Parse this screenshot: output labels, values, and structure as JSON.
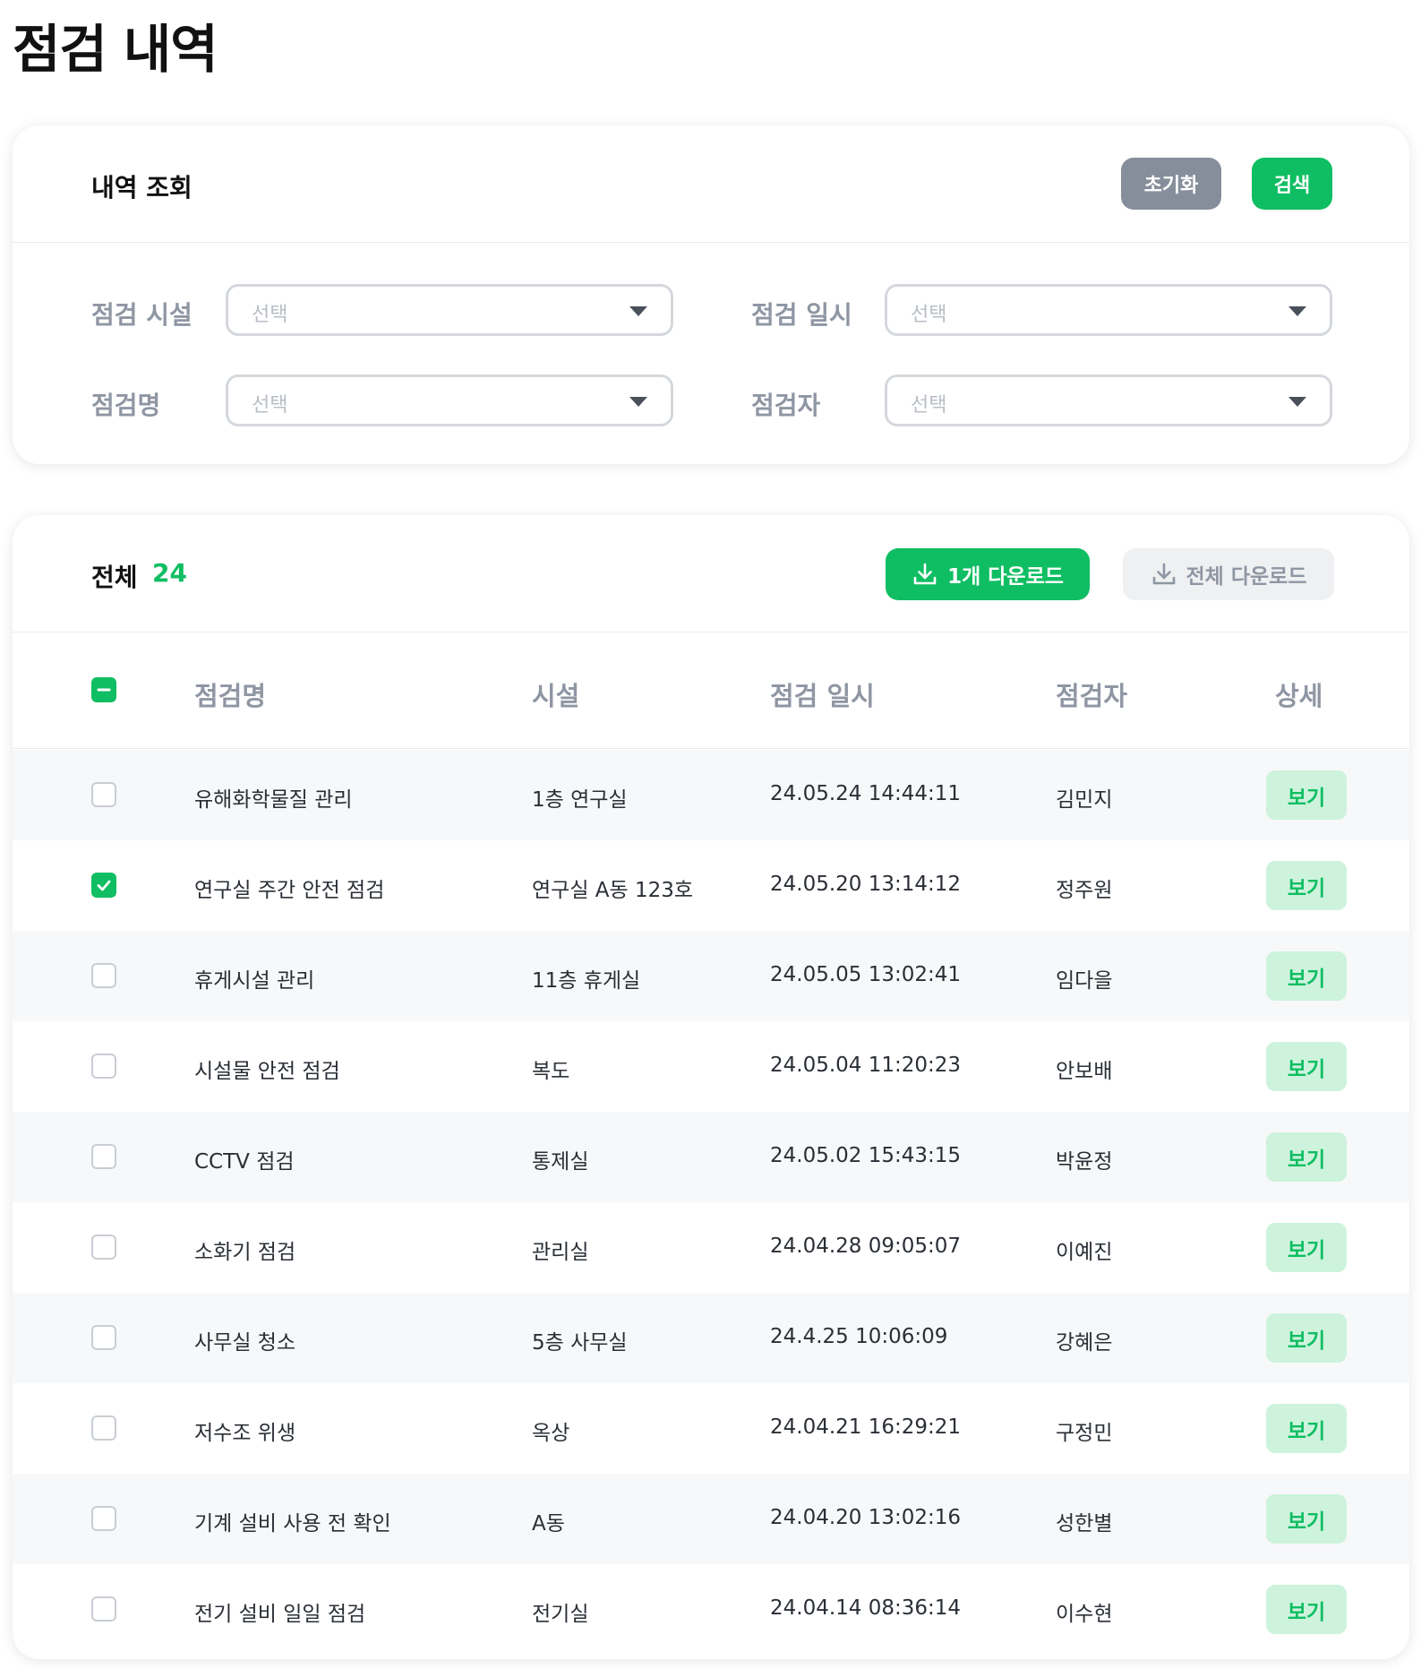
{
  "page": {
    "title": "점검 내역"
  },
  "filter": {
    "title": "내역 조회",
    "reset_label": "초기화",
    "search_label": "검색",
    "fields": [
      {
        "label": "점검 시설",
        "placeholder": "선택"
      },
      {
        "label": "점검 일시",
        "placeholder": "선택"
      },
      {
        "label": "점검명",
        "placeholder": "선택"
      },
      {
        "label": "점검자",
        "placeholder": "선택"
      }
    ]
  },
  "list": {
    "total_label": "전체",
    "total_count": "24",
    "download_one_label": "1개 다운로드",
    "download_all_label": "전체 다운로드",
    "columns": [
      "점검명",
      "시설",
      "점검 일시",
      "점검자",
      "상세"
    ],
    "view_label": "보기",
    "rows": [
      {
        "checked": false,
        "name": "유해화학물질 관리",
        "facility": "1층 연구실",
        "datetime": "24.05.24 14:44:11",
        "inspector": "김민지"
      },
      {
        "checked": true,
        "name": "연구실 주간 안전 점검",
        "facility": "연구실 A동 123호",
        "datetime": "24.05.20 13:14:12",
        "inspector": "정주원"
      },
      {
        "checked": false,
        "name": "휴게시설 관리",
        "facility": "11층 휴게실",
        "datetime": "24.05.05 13:02:41",
        "inspector": "임다을"
      },
      {
        "checked": false,
        "name": "시설물 안전 점검",
        "facility": "복도",
        "datetime": "24.05.04 11:20:23",
        "inspector": "안보배"
      },
      {
        "checked": false,
        "name": "CCTV 점검",
        "facility": "통제실",
        "datetime": "24.05.02 15:43:15",
        "inspector": "박윤정"
      },
      {
        "checked": false,
        "name": "소화기 점검",
        "facility": "관리실",
        "datetime": "24.04.28 09:05:07",
        "inspector": "이예진"
      },
      {
        "checked": false,
        "name": "사무실 청소",
        "facility": "5층 사무실",
        "datetime": "24.4.25 10:06:09",
        "inspector": "강혜은"
      },
      {
        "checked": false,
        "name": "저수조 위생",
        "facility": "옥상",
        "datetime": "24.04.21 16:29:21",
        "inspector": "구정민"
      },
      {
        "checked": false,
        "name": "기계 설비 사용 전 확인",
        "facility": "A동",
        "datetime": "24.04.20 13:02:16",
        "inspector": "성한별"
      },
      {
        "checked": false,
        "name": "전기 설비 일일 점검",
        "facility": "전기실",
        "datetime": "24.04.14 08:36:14",
        "inspector": "이수현"
      }
    ]
  },
  "colors": {
    "accent": "#0fbe62",
    "accent_light": "#cdf3dd",
    "reset_gray": "#878e9b",
    "label_gray": "#8f96a3"
  }
}
